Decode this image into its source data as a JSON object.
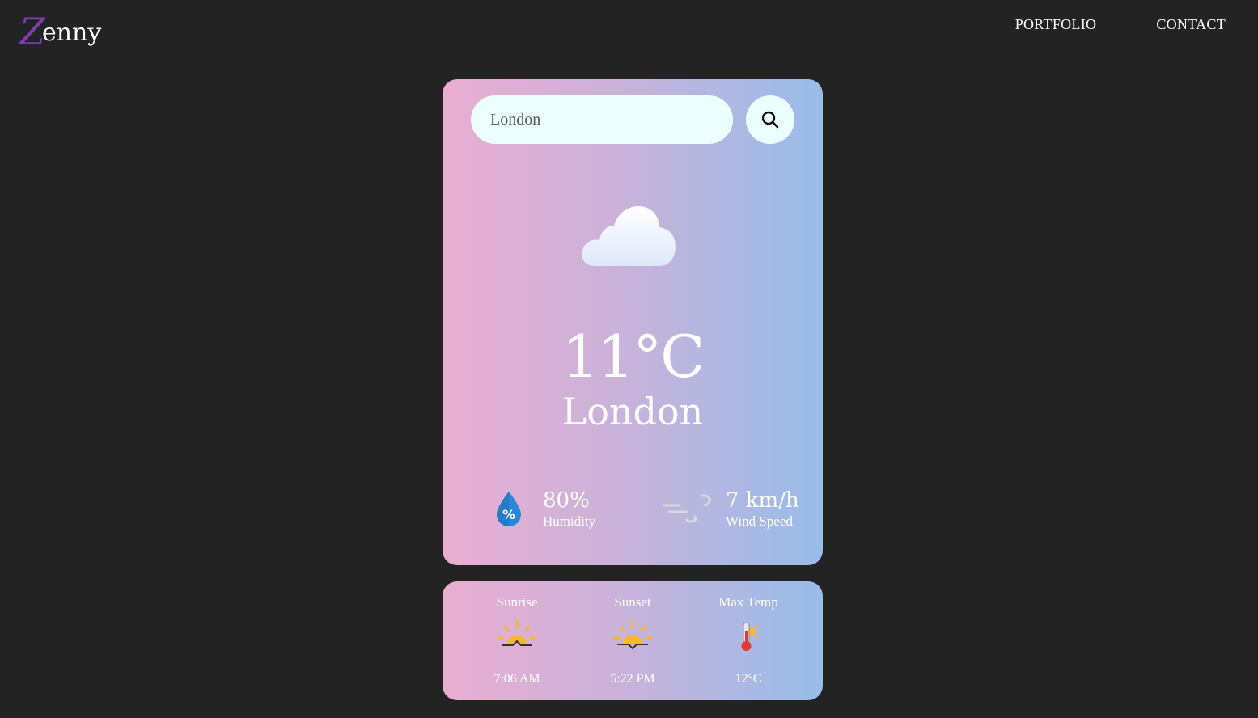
{
  "header": {
    "logo_first": "Z",
    "logo_rest": "enny",
    "nav": [
      {
        "label": "PORTFOLIO"
      },
      {
        "label": "CONTACT"
      }
    ]
  },
  "search": {
    "value": "London",
    "icon": "search-icon"
  },
  "weather": {
    "condition_icon": "cloud-icon",
    "temperature": "11°C",
    "city": "London",
    "humidity": {
      "value": "80%",
      "label": "Humidity",
      "icon": "humidity-icon"
    },
    "wind": {
      "value": "7 km/h",
      "label": "Wind Speed",
      "icon": "wind-icon"
    }
  },
  "sun": [
    {
      "title": "Sunrise",
      "value": "7:06 AM",
      "icon": "sunrise-icon"
    },
    {
      "title": "Sunset",
      "value": "5:22 PM",
      "icon": "sunset-icon"
    },
    {
      "title": "Max Temp",
      "value": "12°C",
      "icon": "thermometer-icon"
    }
  ],
  "colors": {
    "background": "#232323",
    "gradient_start": "#e9aed0",
    "gradient_end": "#98bde9",
    "input_bg": "#ebfffc",
    "logo_accent": "#7b3db0"
  }
}
